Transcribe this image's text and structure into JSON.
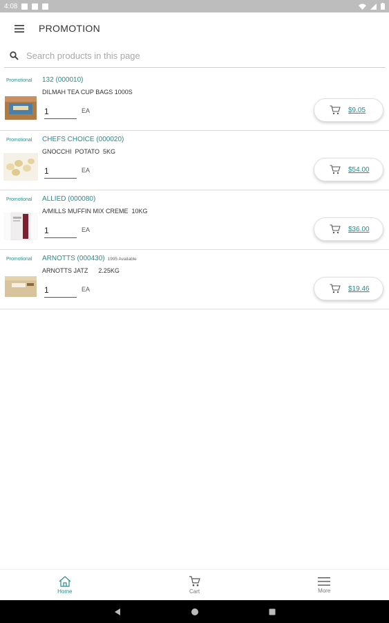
{
  "status_bar": {
    "time": "4:08"
  },
  "header": {
    "title": "PROMOTION",
    "menu_icon": "hamburger-icon"
  },
  "search": {
    "placeholder": "Search products in this page",
    "value": ""
  },
  "products": [
    {
      "badge": "Promotional",
      "code": "132 (000010)",
      "availability": "",
      "description": "DILMAH TEA CUP BAGS 1000S",
      "quantity": "1",
      "uom": "EA",
      "price": "$9.05",
      "image": "tea-box-image"
    },
    {
      "badge": "Promotional",
      "code": "CHEFS CHOICE (000020)",
      "availability": "",
      "description": "GNOCCHI  POTATO  5KG",
      "quantity": "1",
      "uom": "EA",
      "price": "$54.00",
      "image": "gnocchi-image"
    },
    {
      "badge": "Promotional",
      "code": "ALLIED (000080)",
      "availability": "",
      "description": "A/MILLS MUFFIN MIX CREME  10KG",
      "quantity": "1",
      "uom": "EA",
      "price": "$36.00",
      "image": "muffin-mix-bag-image"
    },
    {
      "badge": "Promotional",
      "code": "ARNOTTS (000430)",
      "availability": "1995 Available",
      "description": "ARNOTTS JATZ      2.25KG",
      "quantity": "1",
      "uom": "EA",
      "price": "$19.46",
      "image": "jatz-box-image"
    }
  ],
  "bottom_nav": [
    {
      "label": "Home",
      "icon": "home-icon",
      "active": true
    },
    {
      "label": "Cart",
      "icon": "cart-icon",
      "active": false
    },
    {
      "label": "More",
      "icon": "menu-icon",
      "active": false
    }
  ],
  "colors": {
    "accent": "#2a8a8a",
    "status_bar": "#bdbdbd",
    "system_nav": "#000000"
  }
}
